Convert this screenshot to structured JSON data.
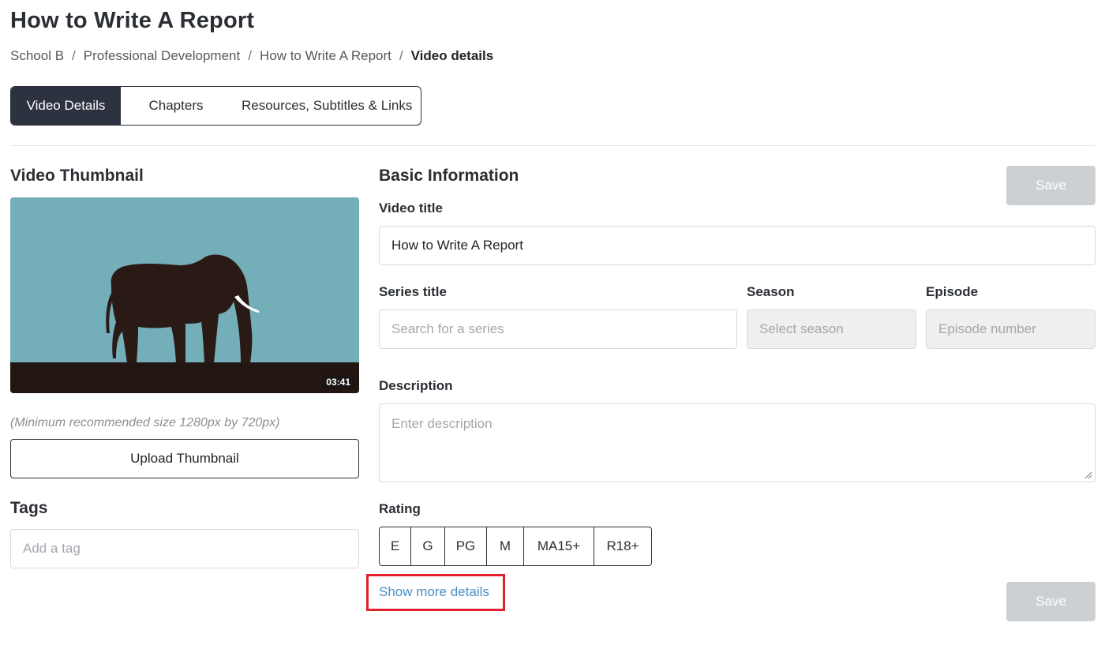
{
  "header": {
    "title": "How to Write A Report",
    "breadcrumb": [
      "School B",
      "Professional Development",
      "How to Write A Report",
      "Video details"
    ],
    "separator": "/"
  },
  "tabs": [
    {
      "label": "Video Details",
      "active": true
    },
    {
      "label": "Chapters",
      "active": false
    },
    {
      "label": "Resources, Subtitles & Links",
      "active": false
    }
  ],
  "thumbnail": {
    "heading": "Video Thumbnail",
    "duration": "03:41",
    "hint": "(Minimum recommended size 1280px by 720px)",
    "upload_label": "Upload Thumbnail",
    "icon": "elephant-silhouette"
  },
  "tags": {
    "heading": "Tags",
    "placeholder": "Add a tag"
  },
  "basic_info": {
    "heading": "Basic Information",
    "save_label": "Save",
    "video_title": {
      "label": "Video title",
      "value": "How to Write A Report"
    },
    "series_title": {
      "label": "Series title",
      "placeholder": "Search for a series"
    },
    "season": {
      "label": "Season",
      "placeholder": "Select season"
    },
    "episode": {
      "label": "Episode",
      "placeholder": "Episode number"
    },
    "description": {
      "label": "Description",
      "placeholder": "Enter description"
    },
    "rating": {
      "label": "Rating",
      "options": [
        "E",
        "G",
        "PG",
        "M",
        "MA15+",
        "R18+"
      ]
    },
    "show_more_label": "Show more details",
    "bottom_save_label": "Save"
  },
  "colors": {
    "tab_active_bg": "#2d3240",
    "save_disabled_bg": "#cdd0d3",
    "link": "#4a8fc4",
    "highlight": "#e0202a",
    "thumb_sky": "#74aeb8",
    "thumb_ground": "#231512"
  }
}
